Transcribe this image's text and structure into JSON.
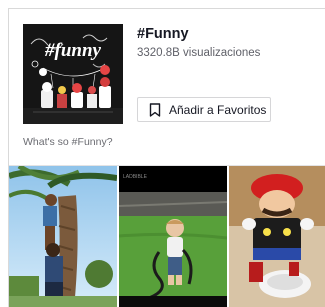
{
  "hashtag": {
    "title": "#Funny",
    "views": "3320.8B visualizaciones",
    "favorite_label": "Añadir a Favoritos",
    "description": "What's so #Funny?",
    "cover_text": "#funny",
    "icons": {
      "favorite": "bookmark-icon"
    }
  },
  "videos": [
    {
      "name": "video-thumbnail-1"
    },
    {
      "name": "video-thumbnail-2",
      "watermark": "LADBIBLE"
    },
    {
      "name": "video-thumbnail-3"
    }
  ]
}
